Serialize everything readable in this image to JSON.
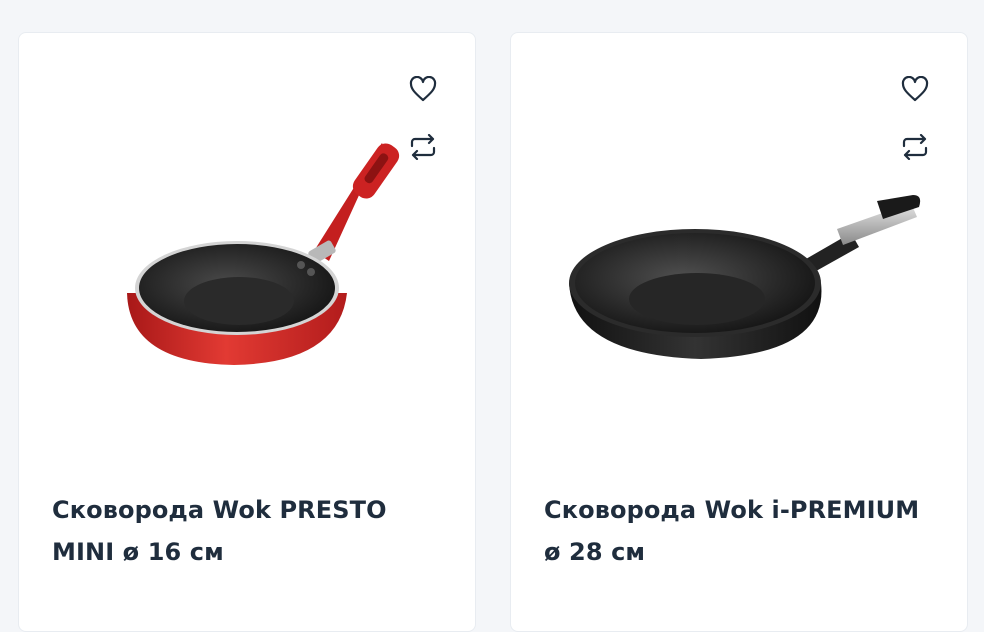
{
  "products": [
    {
      "title": "Сковорода Wok PRESTO MINI ø 16 см",
      "image_icon": "red-wok-pan-image",
      "accent": "#d42a2a"
    },
    {
      "title": "Сковорода Wok i-PREMIUM ø 28 см",
      "image_icon": "black-wok-pan-image",
      "accent": "#2a2a2a"
    }
  ],
  "actions": {
    "favorite_icon": "heart-icon",
    "compare_icon": "compare-arrows-icon"
  }
}
